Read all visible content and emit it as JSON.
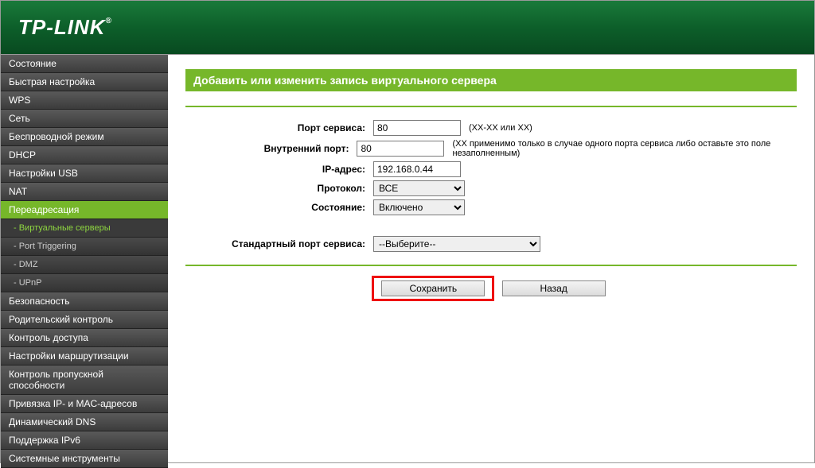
{
  "brand": "TP-LINK",
  "nav": [
    {
      "label": "Состояние"
    },
    {
      "label": "Быстрая настройка"
    },
    {
      "label": "WPS"
    },
    {
      "label": "Сеть"
    },
    {
      "label": "Беспроводной режим"
    },
    {
      "label": "DHCP"
    },
    {
      "label": "Настройки USB"
    },
    {
      "label": "NAT"
    },
    {
      "label": "Переадресация",
      "active": true,
      "subs": [
        {
          "label": "- Виртуальные серверы",
          "active": true
        },
        {
          "label": "- Port Triggering"
        },
        {
          "label": "- DMZ"
        },
        {
          "label": "- UPnP"
        }
      ]
    },
    {
      "label": "Безопасность"
    },
    {
      "label": "Родительский контроль"
    },
    {
      "label": "Контроль доступа"
    },
    {
      "label": "Настройки маршрутизации"
    },
    {
      "label": "Контроль пропускной способности"
    },
    {
      "label": "Привязка IP- и MAC-адресов"
    },
    {
      "label": "Динамический DNS"
    },
    {
      "label": "Поддержка IPv6"
    },
    {
      "label": "Системные инструменты"
    }
  ],
  "panel": {
    "title": "Добавить или изменить запись виртуального сервера"
  },
  "form": {
    "service_port": {
      "label": "Порт сервиса:",
      "value": "80",
      "hint": "(XX-XX или XX)"
    },
    "internal_port": {
      "label": "Внутренний порт:",
      "value": "80",
      "hint": "(XX применимо только в случае одного порта сервиса либо оставьте это поле незаполненным)"
    },
    "ip": {
      "label": "IP-адрес:",
      "value": "192.168.0.44"
    },
    "protocol": {
      "label": "Протокол:",
      "value": "ВСЕ"
    },
    "state": {
      "label": "Состояние:",
      "value": "Включено"
    },
    "std_port": {
      "label": "Стандартный порт сервиса:",
      "value": "--Выберите--"
    }
  },
  "buttons": {
    "save": "Сохранить",
    "back": "Назад"
  }
}
